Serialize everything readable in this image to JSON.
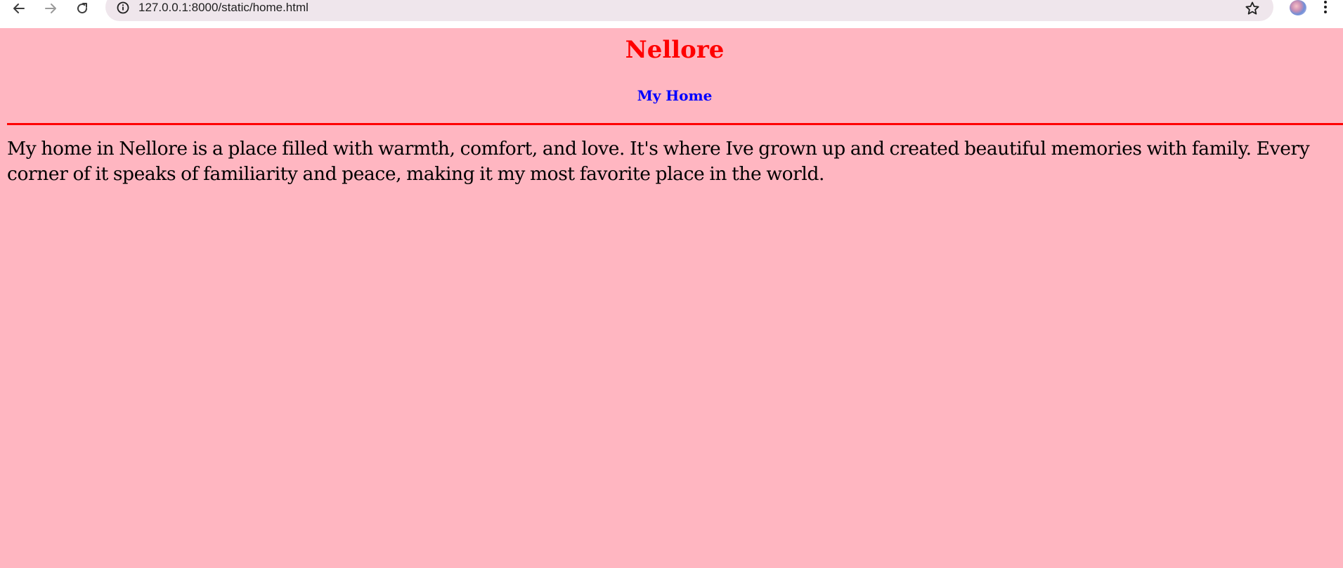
{
  "browser": {
    "url": "127.0.0.1:8000/static/home.html",
    "icons": {
      "back": "arrow-left-icon",
      "forward": "arrow-right-icon",
      "reload": "reload-icon",
      "site_info": "info-icon",
      "bookmark": "star-icon",
      "profile": "profile-avatar",
      "menu": "vertical-dots-icon"
    }
  },
  "page": {
    "title": "Nellore",
    "subtitle": "My Home",
    "paragraph": "My home in Nellore is a place filled with warmth, comfort, and love. It's where Ive grown up and created beautiful memories with family. Every corner of it speaks of familiarity and peace, making it my most favorite place in the world."
  },
  "colors": {
    "background": "#ffb6c1",
    "title": "#ff0000",
    "subtitle": "#0000ff",
    "divider": "#ff0000",
    "text": "#000000"
  }
}
